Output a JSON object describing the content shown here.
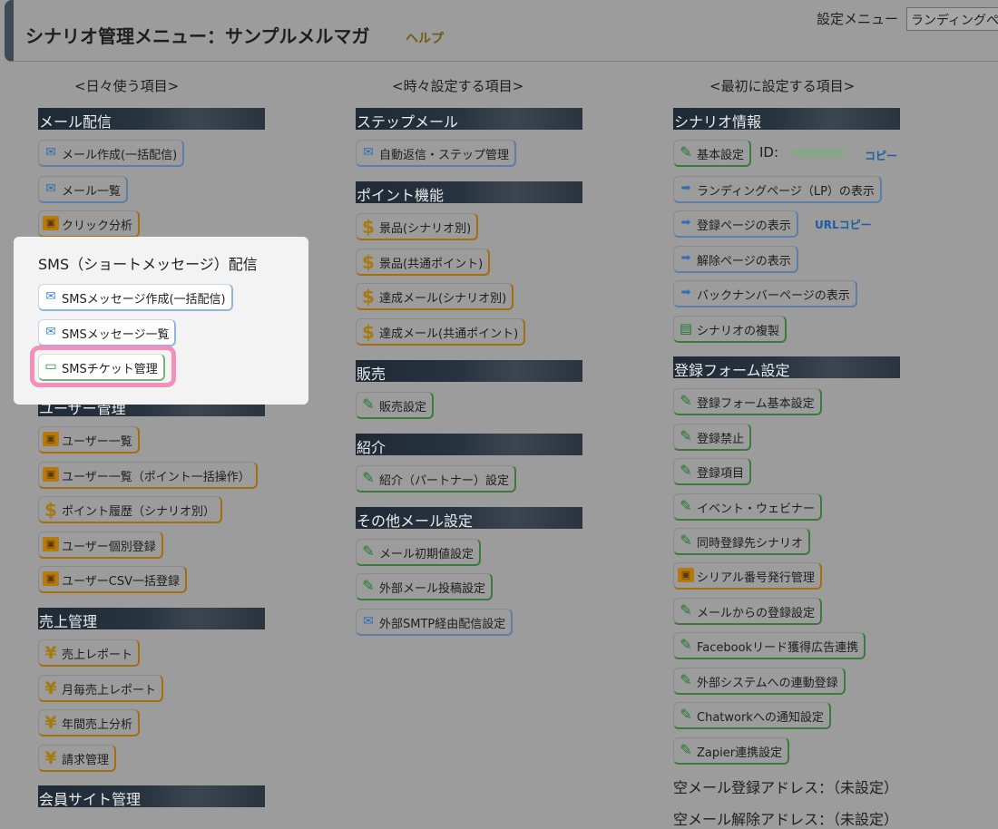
{
  "header": {
    "title": "シナリオ管理メニュー：サンプルメルマガ",
    "help": "ヘルプ",
    "settings_label": "設定メニュー",
    "settings_selected": "ランディングペ"
  },
  "columns": {
    "daily_head": "<日々使う項目>",
    "sometimes_head": "<時々設定する項目>",
    "first_head": "<最初に設定する項目>"
  },
  "col1": {
    "mail_section": "メール配信",
    "mail_create": "メール作成(一括配信)",
    "mail_list": "メール一覧",
    "click_analysis": "クリック分析",
    "sms_section": "SMS（ショートメッセージ）配信",
    "sms_create": "SMSメッセージ作成(一括配信)",
    "sms_list": "SMSメッセージ一覧",
    "sms_ticket": "SMSチケット管理",
    "user_section": "ユーザー管理",
    "user_list": "ユーザー一覧",
    "user_list_point": "ユーザー一覧（ポイント一括操作）",
    "point_history": "ポイント履歴（シナリオ別）",
    "user_register": "ユーザー個別登録",
    "user_csv": "ユーザーCSV一括登録",
    "sales_section": "売上管理",
    "sales_report": "売上レポート",
    "monthly_report": "月毎売上レポート",
    "annual_analysis": "年間売上分析",
    "billing": "請求管理",
    "member_section": "会員サイト管理"
  },
  "col2": {
    "step_section": "ステップメール",
    "autoreply": "自動返信・ステップ管理",
    "point_section": "ポイント機能",
    "prize_scenario": "景品(シナリオ別)",
    "prize_common": "景品(共通ポイント)",
    "achieve_scenario": "達成メール(シナリオ別)",
    "achieve_common": "達成メール(共通ポイント)",
    "sales_section": "販売",
    "sales_settings": "販売設定",
    "intro_section": "紹介",
    "partner_settings": "紹介（パートナー）設定",
    "other_section": "その他メール設定",
    "mail_default": "メール初期値設定",
    "external_post": "外部メール投稿設定",
    "external_smtp": "外部SMTP経由配信設定"
  },
  "col3": {
    "info_section": "シナリオ情報",
    "basic_settings": "基本設定",
    "id_label": "ID:",
    "copy": "コピー",
    "lp_show": "ランディングページ（LP）の表示",
    "register_page": "登録ページの表示",
    "url_copy": "URLコピー",
    "cancel_page": "解除ページの表示",
    "backnumber": "バックナンバーページの表示",
    "duplicate": "シナリオの複製",
    "form_section": "登録フォーム設定",
    "form_basic": "登録フォーム基本設定",
    "reg_ban": "登録禁止",
    "reg_items": "登録項目",
    "event": "イベント・ウェビナー",
    "simul": "同時登録先シナリオ",
    "serial": "シリアル番号発行管理",
    "from_mail": "メールからの登録設定",
    "facebook": "Facebookリード獲得広告連携",
    "external_sys": "外部システムへの連動登録",
    "chatwork": "Chatworkへの通知設定",
    "zapier": "Zapier連携設定",
    "empty_reg": "空メール登録アドレス：（未設定）",
    "empty_cancel": "空メール解除アドレス：（未設定）"
  }
}
